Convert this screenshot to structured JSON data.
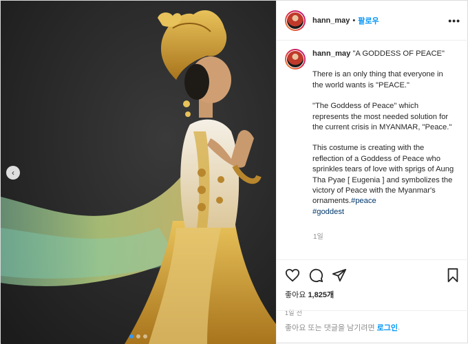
{
  "header": {
    "username": "hann_may",
    "separator": "•",
    "follow_label": "팔로우",
    "more_label": "•••"
  },
  "caption": {
    "username": "hann_may",
    "title": "\"A GODDESS OF PEACE\"",
    "para1": "There is an only thing that everyone in the world wants is \"PEACE.\"",
    "para2": "\"The Goddess of Peace\" which represents the most needed solution for the current crisis in MYANMAR, \"Peace.\"",
    "para3": "This costume is creating with the reflection of a Goddess of Peace who sprinkles tears of love with sprigs of Aung Tha Pyae [ Eugenia ] and symbolizes the victory of Peace with the Myanmar's ornaments.",
    "hashtag1": "#peace",
    "hashtag2": "#goddest",
    "time": "1일"
  },
  "actions": {
    "likes_prefix": "좋아요",
    "likes_count": "1,825개",
    "date": "1일 전"
  },
  "login": {
    "prefix": "좋아요 또는 댓글을 남기려면",
    "link": "로그인",
    "suffix": "."
  },
  "carousel": {
    "prev_icon": "chevron-left-icon",
    "prev_glyph": "‹",
    "dot_count": 3,
    "active_dot": 0
  },
  "colors": {
    "link": "#0095f6",
    "hashtag": "#00376b",
    "gold": "#c9962a",
    "photo_bg": "#2a2a2a"
  }
}
